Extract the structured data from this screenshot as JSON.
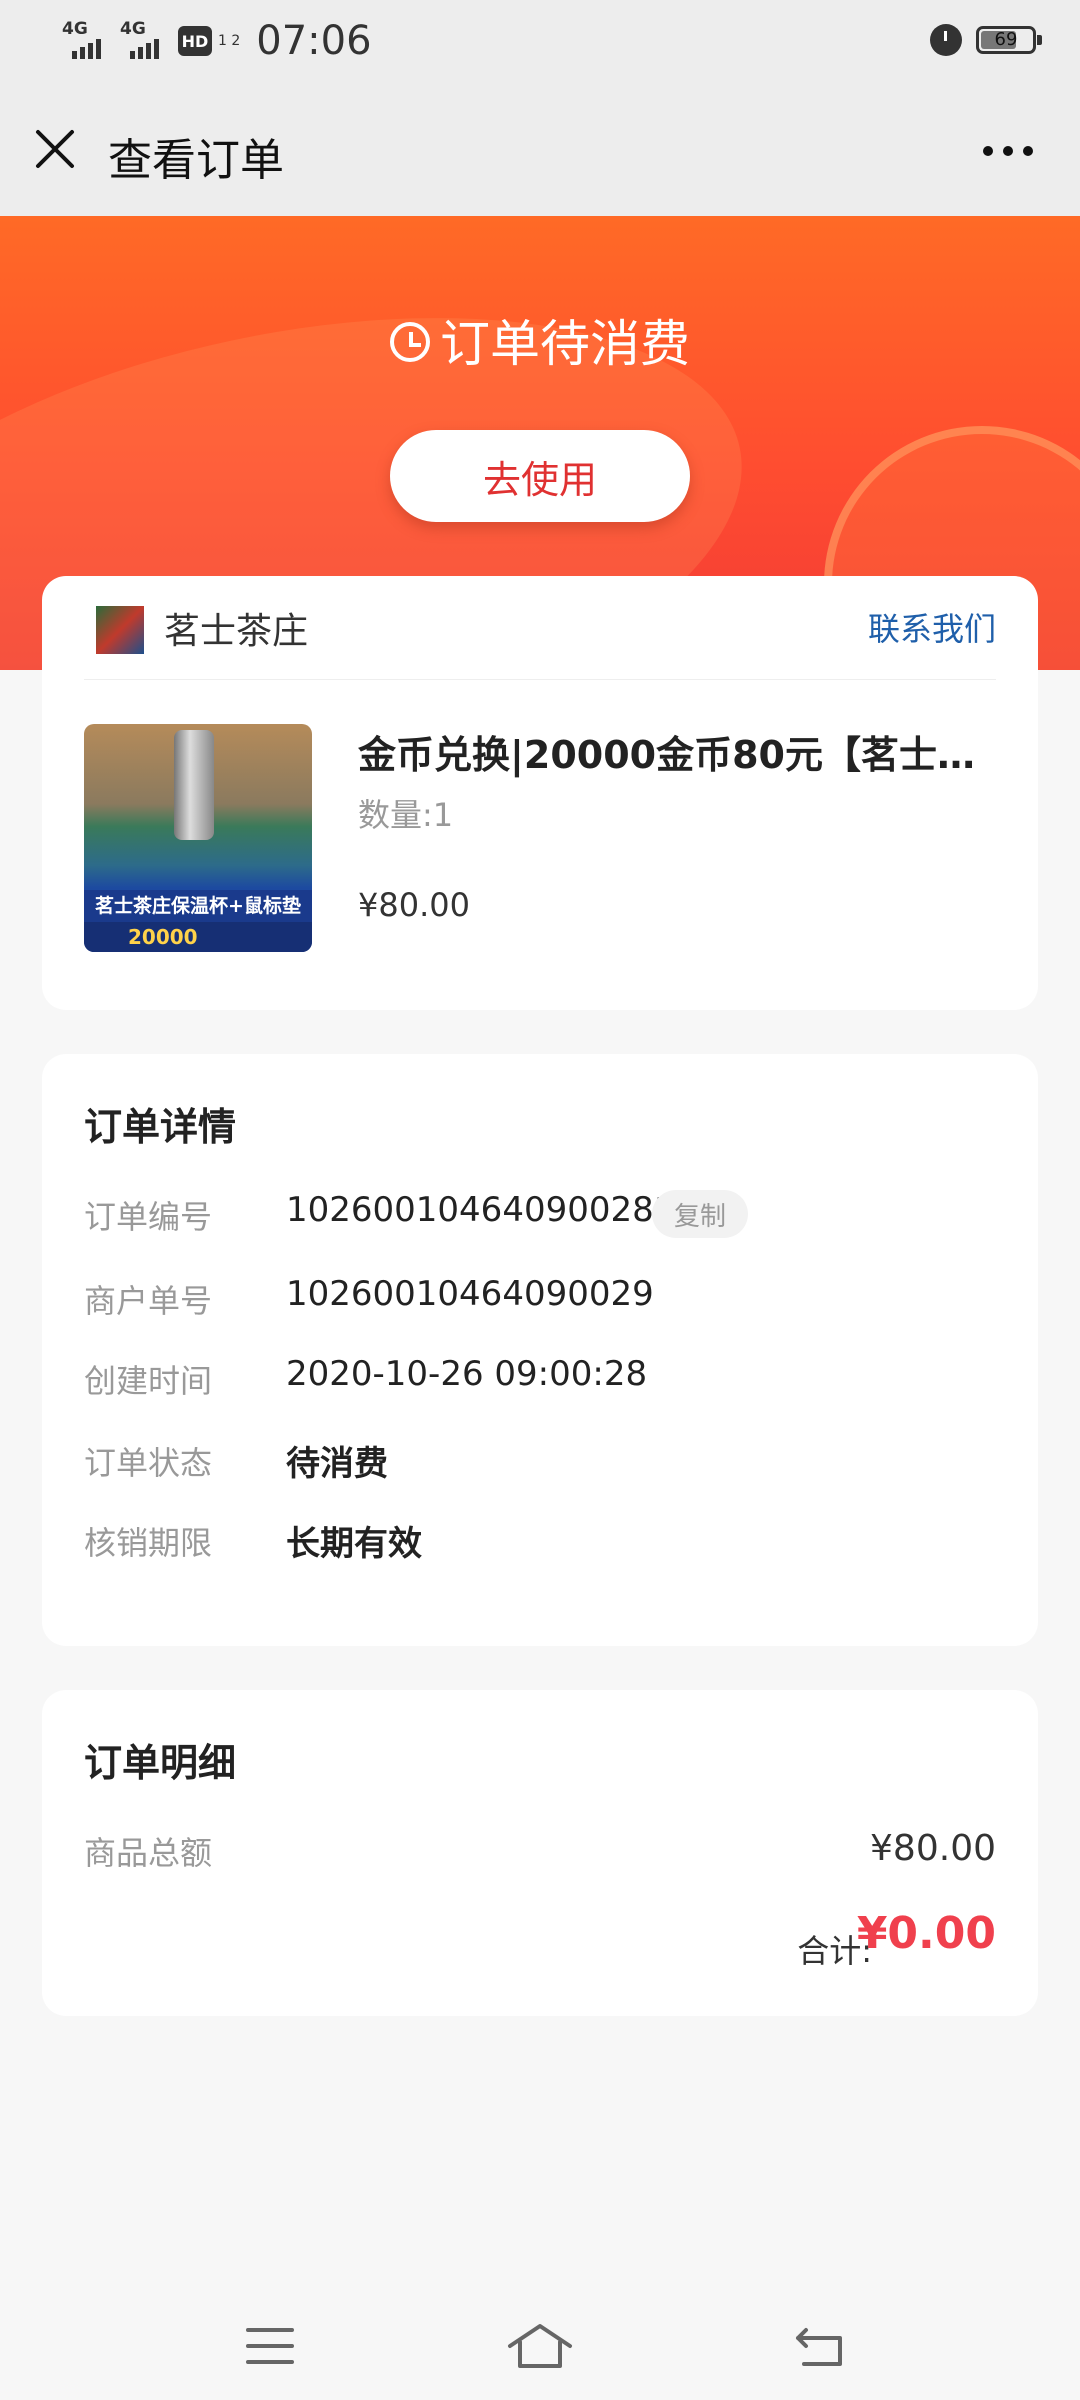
{
  "status_bar": {
    "network_1": "4G",
    "network_2": "4G",
    "hd_label": "HD",
    "hd_sub": "1 2",
    "time": "07:06",
    "battery": "69",
    "battery_level": 0.69
  },
  "nav": {
    "title": "查看订单",
    "close_icon": "close-icon",
    "more_icon": "more-icon"
  },
  "hero": {
    "status": "订单待消费",
    "use_button": "去使用"
  },
  "store": {
    "name": "茗士茶庄",
    "contact": "联系我们"
  },
  "product": {
    "title": "金币兑换|20000金币80元【茗士…",
    "quantity": "数量:1",
    "price": "¥80.00",
    "image_caption": "茗士茶庄保温杯+鼠标垫",
    "image_price": "20000"
  },
  "order_detail": {
    "title": "订单详情",
    "rows": [
      {
        "label": "订单编号",
        "value": "102600104640900281"
      },
      {
        "label": "商户单号",
        "value": "10260010464090029"
      },
      {
        "label": "创建时间",
        "value": "2020-10-26 09:00:28"
      },
      {
        "label": "订单状态",
        "value": "待消费"
      },
      {
        "label": "核销期限",
        "value": "长期有效"
      }
    ],
    "copy_button": "复制"
  },
  "order_bill": {
    "title": "订单明细",
    "subtotal_label": "商品总额",
    "subtotal_value": "¥80.00",
    "total_label": "合计:",
    "total_value": "¥0.00"
  },
  "colors": {
    "accent": "#ff5a2a",
    "link": "#1f5faa",
    "total": "#f0404d"
  }
}
